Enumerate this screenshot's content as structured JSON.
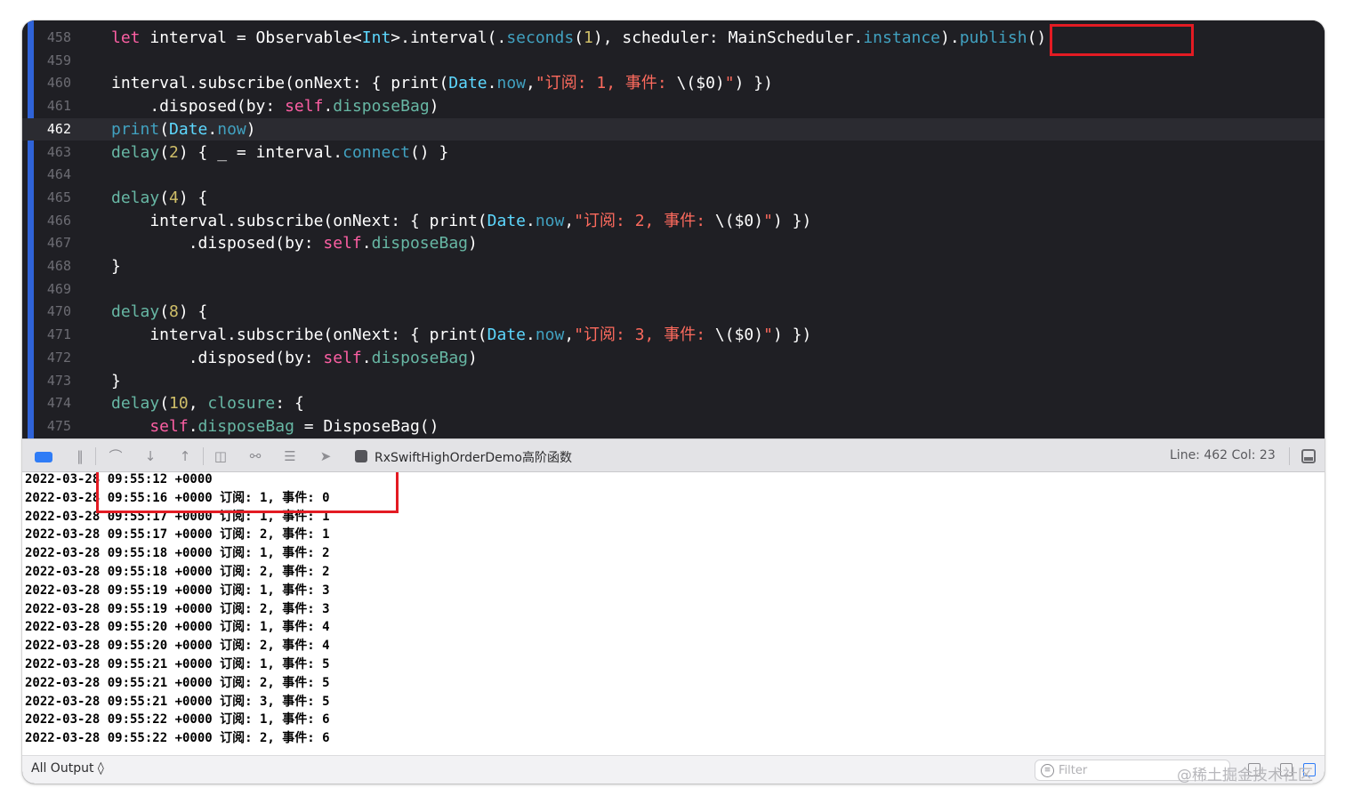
{
  "editor": {
    "current_line": "462",
    "lines": [
      {
        "no": "458",
        "tokens": [
          [
            "kw",
            "let"
          ],
          [
            "plain",
            " interval = Observable<"
          ],
          [
            "type",
            "Int"
          ],
          [
            "plain",
            ">.interval(."
          ],
          [
            "member",
            "seconds"
          ],
          [
            "plain",
            "("
          ],
          [
            "num",
            "1"
          ],
          [
            "plain",
            "), scheduler: MainScheduler."
          ],
          [
            "member",
            "instance"
          ],
          [
            "plain",
            ")."
          ],
          [
            "member",
            "publish"
          ],
          [
            "plain",
            "()"
          ]
        ]
      },
      {
        "no": "459",
        "tokens": []
      },
      {
        "no": "460",
        "tokens": [
          [
            "plain",
            "interval.subscribe(onNext: { print("
          ],
          [
            "type",
            "Date"
          ],
          [
            "plain",
            "."
          ],
          [
            "member",
            "now"
          ],
          [
            "plain",
            ","
          ],
          [
            "str",
            "\"订阅: 1, 事件: "
          ],
          [
            "plain",
            "\\($0)"
          ],
          [
            "str",
            "\""
          ],
          [
            "plain",
            ") })"
          ]
        ]
      },
      {
        "no": "461",
        "tokens": [
          [
            "plain",
            "    .disposed(by: "
          ],
          [
            "kw",
            "self"
          ],
          [
            "plain",
            "."
          ],
          [
            "project",
            "disposeBag"
          ],
          [
            "plain",
            ")"
          ]
        ]
      },
      {
        "no": "462",
        "tokens": [
          [
            "member",
            "print"
          ],
          [
            "plain",
            "("
          ],
          [
            "type",
            "Date"
          ],
          [
            "plain",
            "."
          ],
          [
            "member",
            "now"
          ],
          [
            "plain",
            ")"
          ]
        ]
      },
      {
        "no": "463",
        "tokens": [
          [
            "project",
            "delay"
          ],
          [
            "plain",
            "("
          ],
          [
            "num",
            "2"
          ],
          [
            "plain",
            ") { _ = interval."
          ],
          [
            "member",
            "connect"
          ],
          [
            "plain",
            "() }"
          ]
        ]
      },
      {
        "no": "464",
        "tokens": []
      },
      {
        "no": "465",
        "tokens": [
          [
            "project",
            "delay"
          ],
          [
            "plain",
            "("
          ],
          [
            "num",
            "4"
          ],
          [
            "plain",
            ") {"
          ]
        ]
      },
      {
        "no": "466",
        "tokens": [
          [
            "plain",
            "    interval.subscribe(onNext: { print("
          ],
          [
            "type",
            "Date"
          ],
          [
            "plain",
            "."
          ],
          [
            "member",
            "now"
          ],
          [
            "plain",
            ","
          ],
          [
            "str",
            "\"订阅: 2, 事件: "
          ],
          [
            "plain",
            "\\($0)"
          ],
          [
            "str",
            "\""
          ],
          [
            "plain",
            ") })"
          ]
        ]
      },
      {
        "no": "467",
        "tokens": [
          [
            "plain",
            "        .disposed(by: "
          ],
          [
            "kw",
            "self"
          ],
          [
            "plain",
            "."
          ],
          [
            "project",
            "disposeBag"
          ],
          [
            "plain",
            ")"
          ]
        ]
      },
      {
        "no": "468",
        "tokens": [
          [
            "plain",
            "}"
          ]
        ]
      },
      {
        "no": "469",
        "tokens": []
      },
      {
        "no": "470",
        "tokens": [
          [
            "project",
            "delay"
          ],
          [
            "plain",
            "("
          ],
          [
            "num",
            "8"
          ],
          [
            "plain",
            ") {"
          ]
        ]
      },
      {
        "no": "471",
        "tokens": [
          [
            "plain",
            "    interval.subscribe(onNext: { print("
          ],
          [
            "type",
            "Date"
          ],
          [
            "plain",
            "."
          ],
          [
            "member",
            "now"
          ],
          [
            "plain",
            ","
          ],
          [
            "str",
            "\"订阅: 3, 事件: "
          ],
          [
            "plain",
            "\\($0)"
          ],
          [
            "str",
            "\""
          ],
          [
            "plain",
            ") })"
          ]
        ]
      },
      {
        "no": "472",
        "tokens": [
          [
            "plain",
            "        .disposed(by: "
          ],
          [
            "kw",
            "self"
          ],
          [
            "plain",
            "."
          ],
          [
            "project",
            "disposeBag"
          ],
          [
            "plain",
            ")"
          ]
        ]
      },
      {
        "no": "473",
        "tokens": [
          [
            "plain",
            "}"
          ]
        ]
      },
      {
        "no": "474",
        "tokens": [
          [
            "project",
            "delay"
          ],
          [
            "plain",
            "("
          ],
          [
            "num",
            "10"
          ],
          [
            "plain",
            ", "
          ],
          [
            "project",
            "closure"
          ],
          [
            "plain",
            ": {"
          ]
        ]
      },
      {
        "no": "475",
        "tokens": [
          [
            "kw",
            "    self"
          ],
          [
            "plain",
            "."
          ],
          [
            "project",
            "disposeBag"
          ],
          [
            "plain",
            " = DisposeBag()"
          ]
        ]
      }
    ]
  },
  "debug_bar": {
    "target_name": "RxSwiftHighOrderDemo高阶函数",
    "line_col": "Line: 462  Col: 23",
    "icons": [
      "breakpoints-toggle-icon",
      "pause-icon",
      "step-over-icon",
      "step-into-icon",
      "step-out-icon",
      "view-debugger-icon",
      "memory-graph-icon",
      "environment-overrides-icon",
      "simulate-location-icon"
    ]
  },
  "console": {
    "lines": [
      "2022-03-28 09:55:12 +0000",
      "2022-03-28 09:55:16 +0000 订阅: 1, 事件: 0",
      "2022-03-28 09:55:17 +0000 订阅: 1, 事件: 1",
      "2022-03-28 09:55:17 +0000 订阅: 2, 事件: 1",
      "2022-03-28 09:55:18 +0000 订阅: 1, 事件: 2",
      "2022-03-28 09:55:18 +0000 订阅: 2, 事件: 2",
      "2022-03-28 09:55:19 +0000 订阅: 1, 事件: 3",
      "2022-03-28 09:55:19 +0000 订阅: 2, 事件: 3",
      "2022-03-28 09:55:20 +0000 订阅: 1, 事件: 4",
      "2022-03-28 09:55:20 +0000 订阅: 2, 事件: 4",
      "2022-03-28 09:55:21 +0000 订阅: 1, 事件: 5",
      "2022-03-28 09:55:21 +0000 订阅: 2, 事件: 5",
      "2022-03-28 09:55:21 +0000 订阅: 3, 事件: 5",
      "2022-03-28 09:55:22 +0000 订阅: 1, 事件: 6",
      "2022-03-28 09:55:22 +0000 订阅: 2, 事件: 6"
    ]
  },
  "footer": {
    "output_select": "All Output ◊",
    "filter_placeholder": "Filter",
    "watermark": "@稀土掘金技术社区"
  },
  "colors": {
    "editor_bg": "#1f1f24",
    "keyword": "#fc5fa3",
    "type": "#5dd8ff",
    "member": "#41a1c0",
    "string": "#fc6a5d",
    "number": "#d0bf69",
    "project": "#67b7a4",
    "highlight_box": "#e31b23",
    "accent": "#2f63d8"
  }
}
